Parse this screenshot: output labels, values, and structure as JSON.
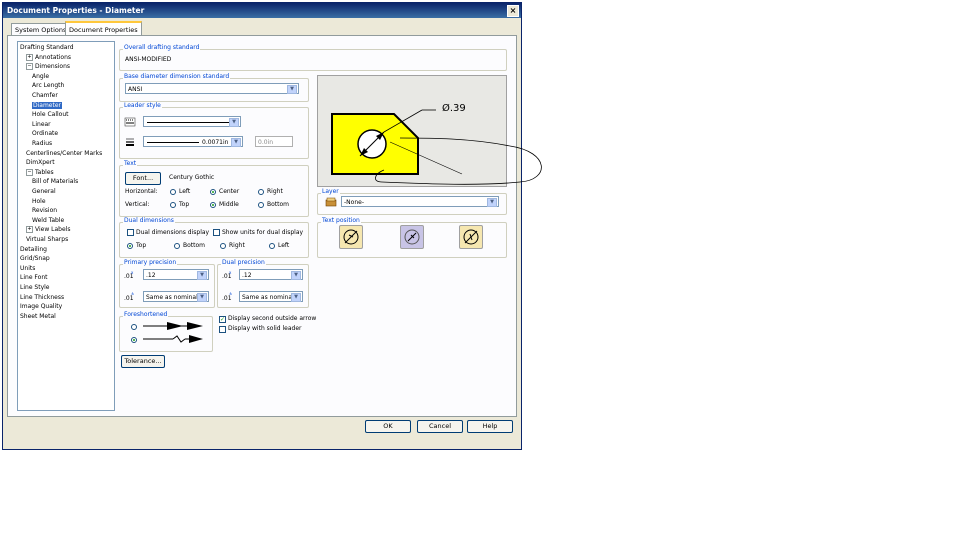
{
  "window": {
    "title": "Document Properties - Diameter",
    "close": "×"
  },
  "tabs": [
    "System Options",
    "Document Properties"
  ],
  "tree": [
    {
      "label": "Drafting Standard",
      "level": 0,
      "toggle": ""
    },
    {
      "label": "Annotations",
      "level": 1,
      "toggle": "+"
    },
    {
      "label": "Dimensions",
      "level": 1,
      "toggle": "−"
    },
    {
      "label": "Angle",
      "level": 2,
      "toggle": ""
    },
    {
      "label": "Arc Length",
      "level": 2,
      "toggle": ""
    },
    {
      "label": "Chamfer",
      "level": 2,
      "toggle": ""
    },
    {
      "label": "Diameter",
      "level": 2,
      "toggle": "",
      "selected": true
    },
    {
      "label": "Hole Callout",
      "level": 2,
      "toggle": ""
    },
    {
      "label": "Linear",
      "level": 2,
      "toggle": ""
    },
    {
      "label": "Ordinate",
      "level": 2,
      "toggle": ""
    },
    {
      "label": "Radius",
      "level": 2,
      "toggle": ""
    },
    {
      "label": "Centerlines/Center Marks",
      "level": 1,
      "toggle": ""
    },
    {
      "label": "DimXpert",
      "level": 1,
      "toggle": ""
    },
    {
      "label": "Tables",
      "level": 1,
      "toggle": "−"
    },
    {
      "label": "Bill of Materials",
      "level": 2,
      "toggle": ""
    },
    {
      "label": "General",
      "level": 2,
      "toggle": ""
    },
    {
      "label": "Hole",
      "level": 2,
      "toggle": ""
    },
    {
      "label": "Revision",
      "level": 2,
      "toggle": ""
    },
    {
      "label": "Weld Table",
      "level": 2,
      "toggle": ""
    },
    {
      "label": "View Labels",
      "level": 1,
      "toggle": "+"
    },
    {
      "label": "Virtual Sharps",
      "level": 1,
      "toggle": ""
    },
    {
      "label": "Detailing",
      "level": 0,
      "toggle": ""
    },
    {
      "label": "Grid/Snap",
      "level": 0,
      "toggle": ""
    },
    {
      "label": "Units",
      "level": 0,
      "toggle": ""
    },
    {
      "label": "Line Font",
      "level": 0,
      "toggle": ""
    },
    {
      "label": "Line Style",
      "level": 0,
      "toggle": ""
    },
    {
      "label": "Line Thickness",
      "level": 0,
      "toggle": ""
    },
    {
      "label": "Image Quality",
      "level": 0,
      "toggle": ""
    },
    {
      "label": "Sheet Metal",
      "level": 0,
      "toggle": ""
    }
  ],
  "overall": {
    "label": "Overall drafting standard",
    "value": "ANSI-MODIFIED"
  },
  "base": {
    "label": "Base diameter dimension standard",
    "value": "ANSI"
  },
  "leader": {
    "label": "Leader style",
    "thickness": "0.0071in",
    "custom": "0.0in"
  },
  "text": {
    "label": "Text",
    "font_button": "Font...",
    "font_name": "Century Gothic",
    "horizontal": "Horizontal:",
    "vertical": "Vertical:",
    "h_options": [
      "Left",
      "Center",
      "Right"
    ],
    "v_options": [
      "Top",
      "Middle",
      "Bottom"
    ]
  },
  "dual": {
    "label": "Dual dimensions",
    "display": "Dual dimensions display",
    "units": "Show units for dual display",
    "options": [
      "Top",
      "Bottom",
      "Right",
      "Left"
    ]
  },
  "primary": {
    "label": "Primary precision",
    "value": ".12",
    "tol": "Same as nominal"
  },
  "dualprec": {
    "label": "Dual precision",
    "value": ".12",
    "tol": "Same as nominal"
  },
  "foreshortened": {
    "label": "Foreshortened"
  },
  "checks": {
    "second_arrow": "Display second outside arrow",
    "solid_leader": "Display with solid leader",
    "check_mark": "✓"
  },
  "tolerance_button": "Tolerance...",
  "preview": {
    "dim_text": "Ø.39"
  },
  "layer": {
    "label": "Layer",
    "value": "-None-"
  },
  "text_position": {
    "label": "Text position"
  },
  "buttons": {
    "ok": "OK",
    "cancel": "Cancel",
    "help": "Help"
  },
  "arrow_glyph": "▼"
}
